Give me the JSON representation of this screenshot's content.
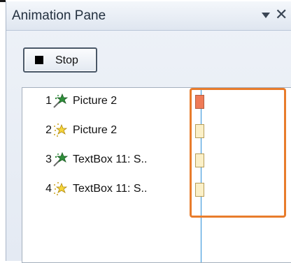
{
  "pane": {
    "title": "Animation Pane",
    "dropdown_icon": "chevron-down-icon",
    "close_glyph": "✕"
  },
  "toolbar": {
    "stop_label": "Stop",
    "stop_icon": "stop-square-icon"
  },
  "animation_list": [
    {
      "number": "1",
      "icon": "emphasis-star-green-icon",
      "label": "Picture 2",
      "state": "active"
    },
    {
      "number": "2",
      "icon": "entrance-star-yellow-icon",
      "label": "Picture 2",
      "state": "normal"
    },
    {
      "number": "3",
      "icon": "emphasis-star-green-icon",
      "label": "TextBox 11: S..",
      "state": "normal"
    },
    {
      "number": "4",
      "icon": "entrance-star-yellow-icon",
      "label": "TextBox 11: S..",
      "state": "normal"
    }
  ],
  "colors": {
    "timeline_line": "#2a8fd8",
    "active_bar": "#ef7b57",
    "normal_bar": "#fbf0c8",
    "highlight": "#e87c2c"
  }
}
